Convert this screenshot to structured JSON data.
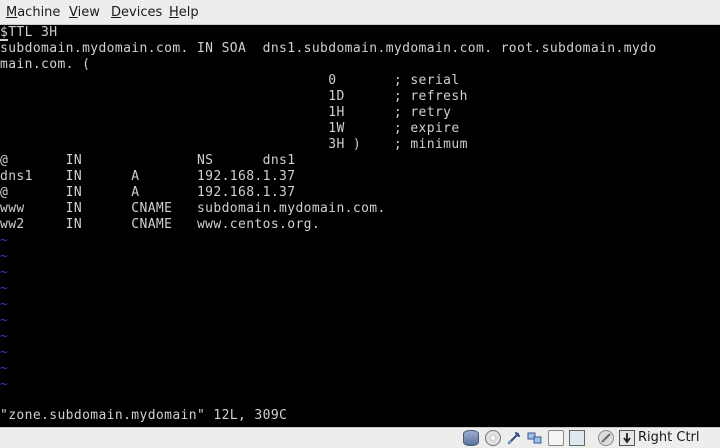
{
  "menubar": {
    "items": [
      {
        "label": "Machine",
        "mnemonic": "M",
        "rest": "achine"
      },
      {
        "label": "View",
        "mnemonic": "V",
        "rest": "iew"
      },
      {
        "label": "Devices",
        "mnemonic": "D",
        "rest": "evices"
      },
      {
        "label": "Help",
        "mnemonic": "H",
        "rest": "elp"
      }
    ]
  },
  "terminal": {
    "lines": [
      "$TTL 3H",
      "subdomain.mydomain.com. IN SOA  dns1.subdomain.mydomain.com. root.subdomain.mydo",
      "main.com. (",
      "                                        0       ; serial",
      "                                        1D      ; refresh",
      "                                        1H      ; retry",
      "                                        1W      ; expire",
      "                                        3H )    ; minimum",
      "@       IN              NS      dns1",
      "dns1    IN      A       192.168.1.37",
      "@       IN      A       192.168.1.37",
      "www     IN      CNAME   subdomain.mydomain.com.",
      "ww2     IN      CNAME   www.centos.org."
    ],
    "tilde_char": "~",
    "tilde_count": 10,
    "status": "\"zone.subdomain.mydomain\" 12L, 309C"
  },
  "statusbar": {
    "icons": [
      "hard-disk-icon",
      "optical-drive-icon",
      "usb-icon",
      "network-icon",
      "shared-folders-icon",
      "display-icon",
      "video-capture-icon",
      "mouse-integration-icon"
    ],
    "host_key": "Right Ctrl"
  }
}
